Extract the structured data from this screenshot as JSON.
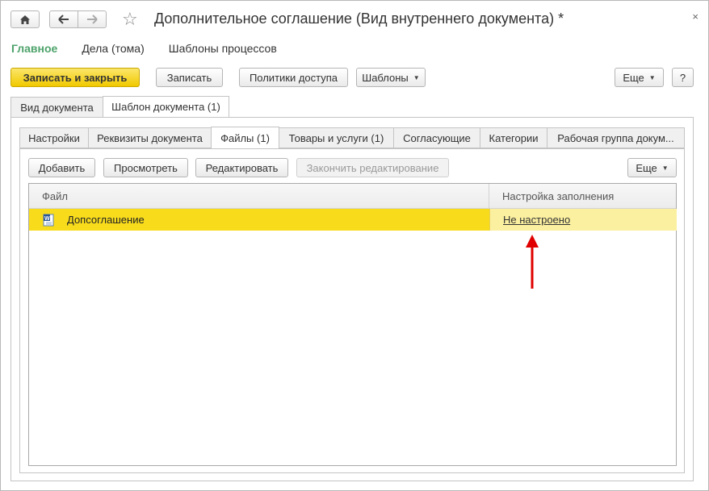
{
  "window": {
    "title": "Дополнительное соглашение (Вид внутреннего документа) *",
    "close": "×"
  },
  "menu": {
    "items": [
      "Главное",
      "Дела (тома)",
      "Шаблоны процессов"
    ]
  },
  "toolbar": {
    "save_close": "Записать и закрыть",
    "save": "Записать",
    "access_policies": "Политики доступа",
    "templates": "Шаблоны",
    "more": "Еще",
    "help": "?"
  },
  "outer_tabs": [
    "Вид документа",
    "Шаблон документа (1)"
  ],
  "inner_tabs": [
    "Настройки",
    "Реквизиты документа",
    "Файлы (1)",
    "Товары и услуги (1)",
    "Согласующие",
    "Категории",
    "Рабочая группа докум..."
  ],
  "files_toolbar": {
    "add": "Добавить",
    "view": "Просмотреть",
    "edit": "Редактировать",
    "finish_edit": "Закончить редактирование",
    "more": "Еще"
  },
  "table": {
    "columns": [
      "Файл",
      "Настройка заполнения"
    ],
    "rows": [
      {
        "file": "Допсоглашение",
        "setting": "Не настроено",
        "icon": "word-document-icon"
      }
    ]
  },
  "colors": {
    "accent_green": "#4da36a",
    "primary_button": "#f1c900",
    "selected_row": "#f8dc1c",
    "selected_row_cell": "#fbf0a0",
    "annotation_arrow": "#e00000"
  }
}
